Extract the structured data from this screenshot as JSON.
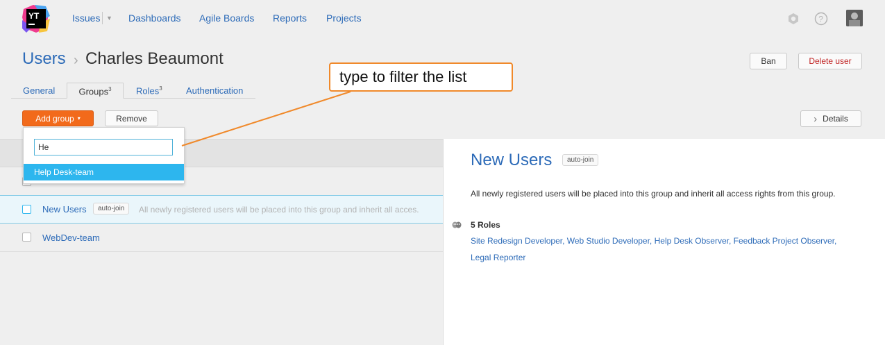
{
  "nav": {
    "issues": "Issues",
    "dashboards": "Dashboards",
    "agile_boards": "Agile Boards",
    "reports": "Reports",
    "projects": "Projects",
    "logo_text": "YT"
  },
  "breadcrumb": {
    "root": "Users",
    "separator": "›",
    "current": "Charles Beaumont"
  },
  "actions": {
    "ban": "Ban",
    "delete_user": "Delete user"
  },
  "tabs": [
    {
      "label": "General",
      "count": ""
    },
    {
      "label": "Groups",
      "count": "3"
    },
    {
      "label": "Roles",
      "count": "3"
    },
    {
      "label": "Authentication",
      "count": ""
    }
  ],
  "toolbar": {
    "add_group": "Add group",
    "add_group_caret": "▾",
    "remove": "Remove",
    "details": "Details",
    "details_chevron": "›"
  },
  "dropdown": {
    "filter_value": "He",
    "item": "Help Desk-team"
  },
  "groups": [
    {
      "name": "New Users",
      "badge": "auto-join",
      "description": "All newly registered users will be placed into this group and inherit all acces."
    },
    {
      "name": "WebDev-team",
      "badge": "",
      "description": ""
    }
  ],
  "details": {
    "title": "New Users",
    "badge": "auto-join",
    "description": "All newly registered users will be placed into this group and inherit all access rights from this group.",
    "roles_count": "5 Roles",
    "roles_line1": "Site Redesign Developer, Web Studio Developer, Help Desk Observer, Feedback Project Observer,",
    "roles_line2": "Legal Reporter"
  },
  "annotation": {
    "text": "type to filter the list"
  },
  "colors": {
    "accent": "#2d6bb8",
    "add_button": "#f26a1b",
    "highlight": "#2db6ee",
    "callout_border": "#f0892a",
    "delete": "#c02222"
  }
}
